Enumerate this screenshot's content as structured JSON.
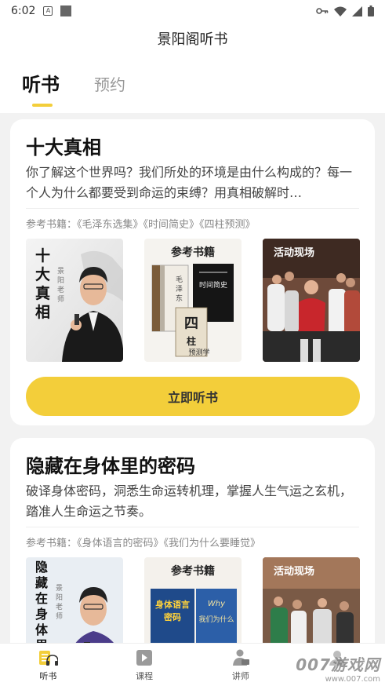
{
  "status_bar": {
    "time": "6:02",
    "a_icon_letter": "A"
  },
  "header": {
    "title": "景阳阁听书"
  },
  "tabs": [
    {
      "label": "听书",
      "active": true
    },
    {
      "label": "预约",
      "active": false
    }
  ],
  "cards": [
    {
      "title": "十大真相",
      "description": "你了解这个世界吗？我们所处的环境是由什么构成的？每一个人为什么都要受到命运的束缚？用真相破解时…",
      "books": "参考书籍：《毛泽东选集》《时间简史》《四柱预测》",
      "images": [
        {
          "caption": "十大真相",
          "side": "景阳老师"
        },
        {
          "caption": "参考书籍",
          "covers": [
            "毛泽东选集",
            "时间简史",
            "四柱",
            "预测学"
          ]
        },
        {
          "caption": "活动现场"
        }
      ],
      "button": "立即听书"
    },
    {
      "title": "隐藏在身体里的密码",
      "description": "破译身体密码，洞悉生命运转机理，掌握人生气运之玄机，踏准人生命运之节奏。",
      "books": "参考书籍：《身体语言的密码》《我们为什么要睡觉》",
      "images": [
        {
          "caption": "隐藏在身体里的",
          "side": "景阳老师"
        },
        {
          "caption": "参考书籍",
          "covers": [
            "身体语言密码",
            "我们为什么"
          ]
        },
        {
          "caption": "活动现场"
        }
      ]
    }
  ],
  "bottom_nav": [
    {
      "label": "听书",
      "icon": "book-headphones-icon",
      "active": true
    },
    {
      "label": "课程",
      "icon": "video-play-icon",
      "active": false
    },
    {
      "label": "讲师",
      "icon": "lecturer-icon",
      "active": false
    },
    {
      "label": "",
      "icon": "profile-icon",
      "active": false
    }
  ],
  "watermark": {
    "main": "007游戏网",
    "sub": "www.007.com"
  },
  "colors": {
    "accent": "#f3ce3a",
    "background": "#f2f2f2",
    "card": "#ffffff"
  }
}
